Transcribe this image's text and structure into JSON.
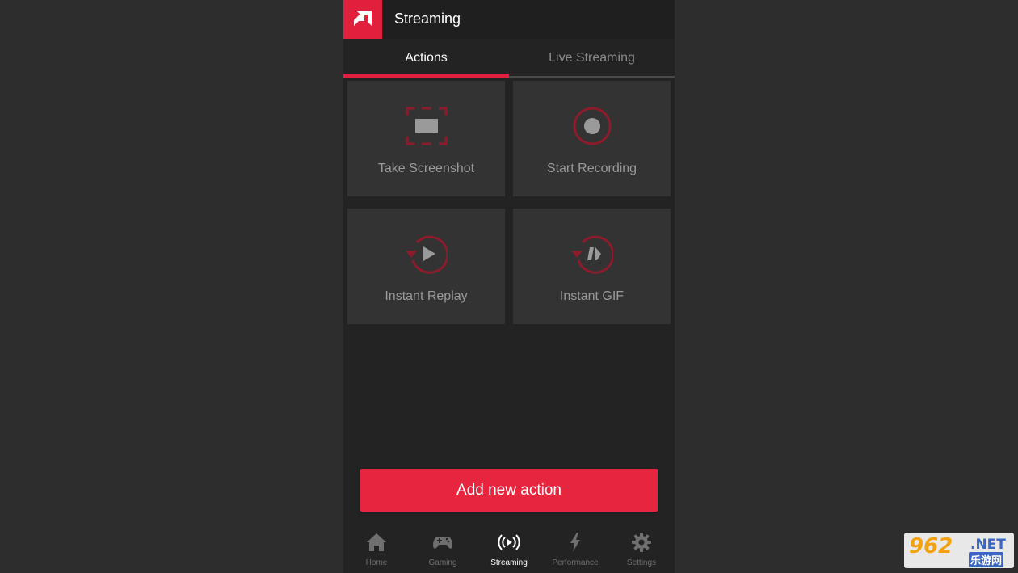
{
  "header": {
    "title": "Streaming",
    "logo_icon": "amd-logo-icon"
  },
  "tabs": [
    {
      "label": "Actions",
      "active": true
    },
    {
      "label": "Live Streaming",
      "active": false
    }
  ],
  "actions": [
    {
      "label": "Take Screenshot",
      "icon": "screenshot-icon"
    },
    {
      "label": "Start Recording",
      "icon": "record-icon"
    },
    {
      "label": "Instant Replay",
      "icon": "instant-replay-icon"
    },
    {
      "label": "Instant GIF",
      "icon": "instant-gif-icon"
    }
  ],
  "add_button": {
    "label": "Add new action"
  },
  "bottom_nav": [
    {
      "label": "Home",
      "icon": "home-icon",
      "active": false
    },
    {
      "label": "Gaming",
      "icon": "gamepad-icon",
      "active": false
    },
    {
      "label": "Streaming",
      "icon": "broadcast-icon",
      "active": true
    },
    {
      "label": "Performance",
      "icon": "lightning-icon",
      "active": false
    },
    {
      "label": "Settings",
      "icon": "gear-icon",
      "active": false
    }
  ],
  "watermark": {
    "number": "962",
    "domain": ".NET",
    "site_name": "乐游网"
  },
  "colors": {
    "accent": "#e0203c",
    "button": "#e8253f",
    "background": "#2d2d2d",
    "panel": "#232323",
    "tile": "#333333",
    "icon_red": "#8c1c2c"
  }
}
